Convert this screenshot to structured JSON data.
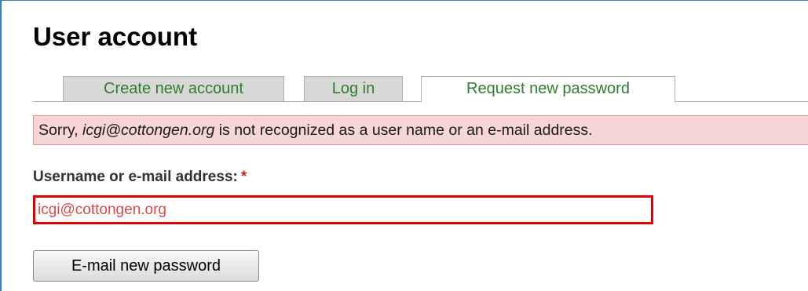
{
  "page": {
    "title": "User account"
  },
  "tabs": [
    {
      "label": "Create new account",
      "active": false
    },
    {
      "label": "Log in",
      "active": false
    },
    {
      "label": "Request new password",
      "active": true
    }
  ],
  "error": {
    "prefix": "Sorry, ",
    "value": "icgi@cottongen.org",
    "suffix": " is not recognized as a user name or an e-mail address."
  },
  "form": {
    "username_label": "Username or e-mail address:",
    "required_marker": "*",
    "username_value": "icgi@cottongen.org",
    "submit_label": "E-mail new password"
  },
  "colors": {
    "tab_text": "#2f7d2f",
    "error_bg": "#f9d6d6",
    "error_border": "#e39090",
    "input_error_border": "#e00000",
    "required": "#cc2222"
  }
}
